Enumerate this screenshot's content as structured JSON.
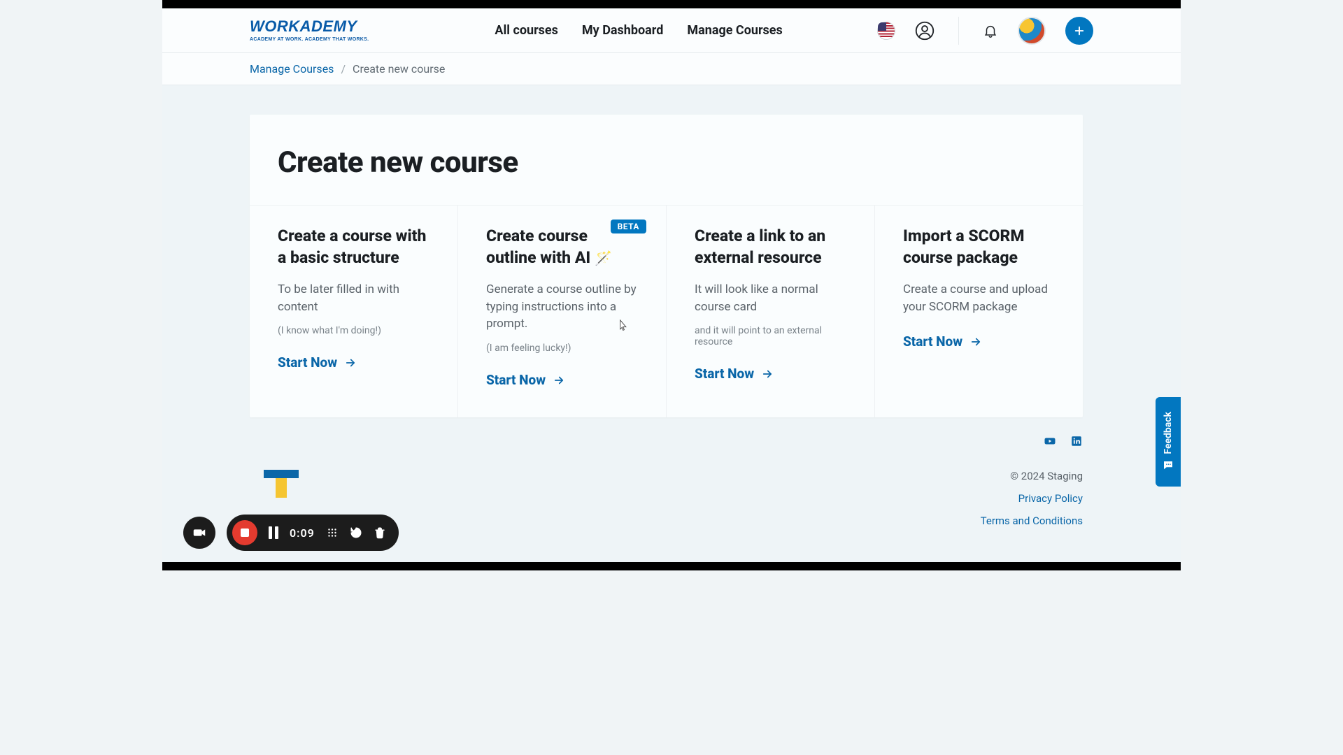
{
  "brand": {
    "name": "WORKADEMY",
    "tagline": "ACADEMY AT WORK. ACADEMY THAT WORKS."
  },
  "nav": {
    "all_courses": "All courses",
    "my_dashboard": "My Dashboard",
    "manage_courses": "Manage Courses"
  },
  "breadcrumb": {
    "parent": "Manage Courses",
    "current": "Create new course"
  },
  "page": {
    "title": "Create new course"
  },
  "options": [
    {
      "title": "Create a course with a basic structure",
      "desc": "To be later filled in with content",
      "note": "(I know what I'm doing!)",
      "cta": "Start Now"
    },
    {
      "title": "Create course outline with AI",
      "badge": "BETA",
      "wand": true,
      "desc": "Generate a course outline by typing instructions into a prompt.",
      "note": "(I am feeling lucky!)",
      "cta": "Start Now"
    },
    {
      "title": "Create a link to an external resource",
      "desc": "It will look like a normal course card",
      "note": "and it will point to an external resource",
      "cta": "Start Now"
    },
    {
      "title": "Import a SCORM course package",
      "desc": "Create a course and upload your SCORM package",
      "note": "",
      "cta": "Start Now"
    }
  ],
  "footer": {
    "copyright": "© 2024 Staging",
    "privacy": "Privacy Policy",
    "terms": "Terms and Conditions"
  },
  "feedback": {
    "label": "Feedback"
  },
  "recorder": {
    "time": "0:09"
  }
}
